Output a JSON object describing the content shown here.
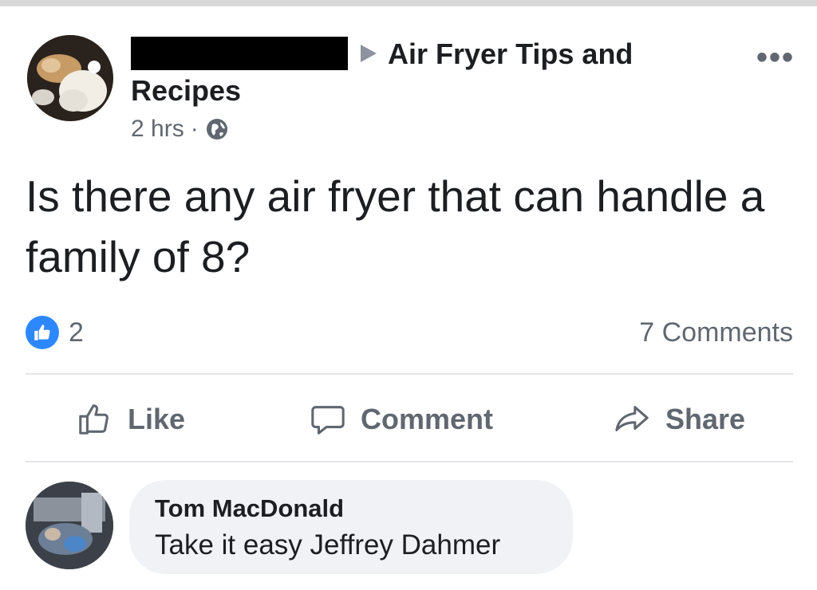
{
  "post": {
    "group_name_line1": "Air Fryer Tips and",
    "group_name_line2": "Recipes",
    "time": "2 hrs",
    "separator": "·",
    "privacy_icon": "globe-icon",
    "more_label": "•••",
    "text": "Is there any air fryer that can handle a family of 8?",
    "reactions": {
      "icon": "like-icon",
      "count": "2"
    },
    "comment_count": "7 Comments"
  },
  "actions": {
    "like": "Like",
    "comment": "Comment",
    "share": "Share"
  },
  "comment": {
    "author": "Tom MacDonald",
    "text": "Take it easy Jeffrey Dahmer"
  },
  "colors": {
    "accent": "#2d88ff",
    "secondary_text": "#606770",
    "bubble": "#f0f2f5",
    "divider": "#e4e6eb"
  }
}
